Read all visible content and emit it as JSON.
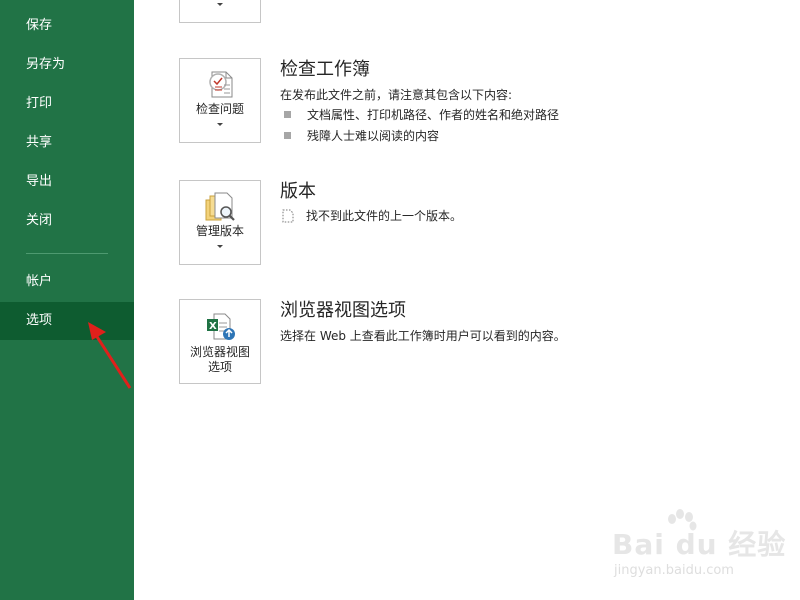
{
  "sidebar": {
    "items": [
      {
        "label": "保存"
      },
      {
        "label": "另存为"
      },
      {
        "label": "打印"
      },
      {
        "label": "共享"
      },
      {
        "label": "导出"
      },
      {
        "label": "关闭"
      },
      {
        "label": "帐户"
      },
      {
        "label": "选项"
      }
    ],
    "selected": "选项",
    "background": "#217346",
    "selected_background": "#0e5c30"
  },
  "sections": {
    "inspect": {
      "button_label": "检查问题",
      "title": "检查工作簿",
      "description": "在发布此文件之前，请注意其包含以下内容:",
      "bullets": [
        "文档属性、打印机路径、作者的姓名和绝对路径",
        "残障人士难以阅读的内容"
      ]
    },
    "versions": {
      "button_label": "管理版本",
      "title": "版本",
      "description": "找不到此文件的上一个版本。"
    },
    "browser": {
      "button_label_line1": "浏览器视图",
      "button_label_line2": "选项",
      "title": "浏览器视图选项",
      "description": "选择在 Web 上查看此工作簿时用户可以看到的内容。"
    }
  },
  "watermark": {
    "logo": "Bai du 经验",
    "url": "jingyan.baidu.com"
  },
  "annotation_color": "#e0201b"
}
